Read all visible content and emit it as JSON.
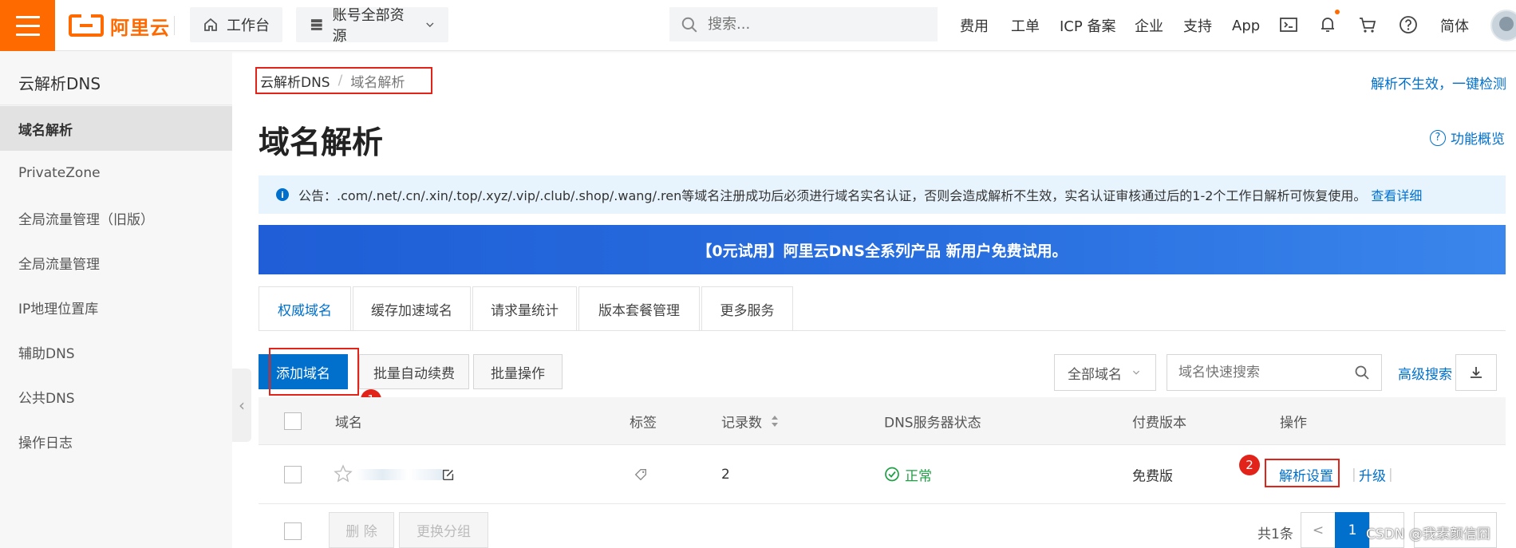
{
  "header": {
    "logo_text": "阿里云",
    "workbench": "工作台",
    "resources": "账号全部资源",
    "search_placeholder": "搜索...",
    "links": [
      "费用",
      "工单",
      "ICP 备案",
      "企业",
      "支持",
      "App"
    ],
    "lang": "简体"
  },
  "sidebar": {
    "title": "云解析DNS",
    "items": [
      {
        "label": "域名解析"
      },
      {
        "label": "PrivateZone"
      },
      {
        "label": "全局流量管理（旧版）"
      },
      {
        "label": "全局流量管理"
      },
      {
        "label": "IP地理位置库"
      },
      {
        "label": "辅助DNS"
      },
      {
        "label": "公共DNS"
      },
      {
        "label": "操作日志"
      }
    ]
  },
  "breadcrumb": {
    "root": "云解析DNS",
    "sep": "/",
    "current": "域名解析"
  },
  "check_link": "解析不生效，一键检测",
  "page_title": "域名解析",
  "overview_link": "功能概览",
  "notice": {
    "icon": "i",
    "text": "公告：.com/.net/.cn/.xin/.top/.xyz/.vip/.club/.shop/.wang/.ren等域名注册成功后必须进行域名实名认证，否则会造成解析不生效，实名认证审核通过后的1-2个工作日解析可恢复使用。",
    "more": "查看详细"
  },
  "banner": "【0元试用】阿里云DNS全系列产品 新用户免费试用。",
  "tabs": [
    {
      "label": "权威域名"
    },
    {
      "label": "缓存加速域名"
    },
    {
      "label": "请求量统计"
    },
    {
      "label": "版本套餐管理"
    },
    {
      "label": "更多服务"
    }
  ],
  "toolbar": {
    "add": "添加域名",
    "renew": "批量自动续费",
    "batch": "批量操作",
    "filter": "全部域名",
    "search_placeholder": "域名快速搜索",
    "advanced": "高级搜索"
  },
  "table": {
    "headers": {
      "domain": "域名",
      "tag": "标签",
      "records": "记录数",
      "dns_status": "DNS服务器状态",
      "plan": "付费版本",
      "ops": "操作"
    },
    "rows": [
      {
        "records": "2",
        "status": "正常",
        "plan": "免费版",
        "op_settings": "解析设置",
        "op_upgrade": "升级"
      }
    ]
  },
  "footer": {
    "delete": "删 除",
    "regroup": "更换分组",
    "total": "共1条",
    "prev": "<",
    "page": "1"
  },
  "annotations": {
    "step1": "1",
    "step2": "2"
  },
  "watermark": "CSDN @我素颜信囧",
  "colors": {
    "brand": "#ff6a00",
    "link": "#0070cc",
    "annotation": "#e2231a",
    "success": "#1fa045"
  }
}
